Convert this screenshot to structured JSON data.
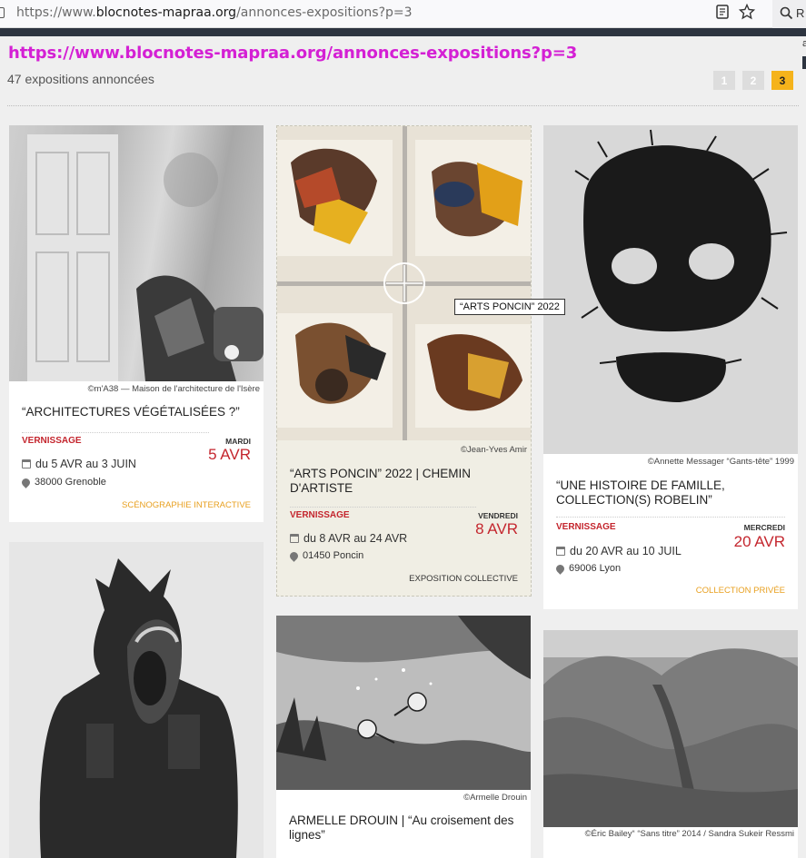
{
  "browser": {
    "url_prefix": "https://www.",
    "url_host": "blocnotes-mapraa.org",
    "url_path": "/annonces-expositions?p=3",
    "search_label": "R",
    "side_letter": "a"
  },
  "overlay_url": "https://www.blocnotes-mapraa.org/annonces-expositions?p=3",
  "count_text": "47 expositions annoncées",
  "pagination": [
    "1",
    "2",
    "3"
  ],
  "tooltip": "“ARTS PONCIN” 2022",
  "cards": [
    {
      "credit": "©m'A38 — Maison de l'architecture de l'Isère",
      "title": "“ARCHITECTURES VÉGÉTALISÉES ?”",
      "vernissage": "VERNISSAGE",
      "day": "MARDI",
      "date": "5 AVR",
      "range": "du 5 AVR au 3 JUIN",
      "place": "38000 Grenoble",
      "category": "SCÉNOGRAPHIE INTERACTIVE"
    },
    {
      "credit": "©Jean-Yves Amir",
      "title": "“ARTS PONCIN” 2022 | CHEMIN D'ARTISTE",
      "vernissage": "VERNISSAGE",
      "day": "VENDREDI",
      "date": "8 AVR",
      "range": "du 8 AVR au 24 AVR",
      "place": "01450 Poncin",
      "category": "EXPOSITION COLLECTIVE"
    },
    {
      "credit": "©Annette Messager “Gants-tête” 1999",
      "title": "“UNE HISTOIRE DE FAMILLE, COLLECTION(S) ROBELIN”",
      "vernissage": "VERNISSAGE",
      "day": "MERCREDI",
      "date": "20 AVR",
      "range": "du 20 AVR au 10 JUIL",
      "place": "69006 Lyon",
      "category": "COLLECTION PRIVÉE"
    },
    {
      "credit": "",
      "title": ""
    },
    {
      "credit": "©Armelle Drouin",
      "title": "ARMELLE DROUIN | “Au croisement des lignes”"
    },
    {
      "credit": "©Éric Bailey“ “Sans titre” 2014 / Sandra Sukeir Ressmi",
      "title": ""
    }
  ],
  "colors": {
    "accent_red": "#c4262e",
    "accent_orange": "#e8a020",
    "page_active": "#f5b31b",
    "overlay_magenta": "#d420d4"
  }
}
